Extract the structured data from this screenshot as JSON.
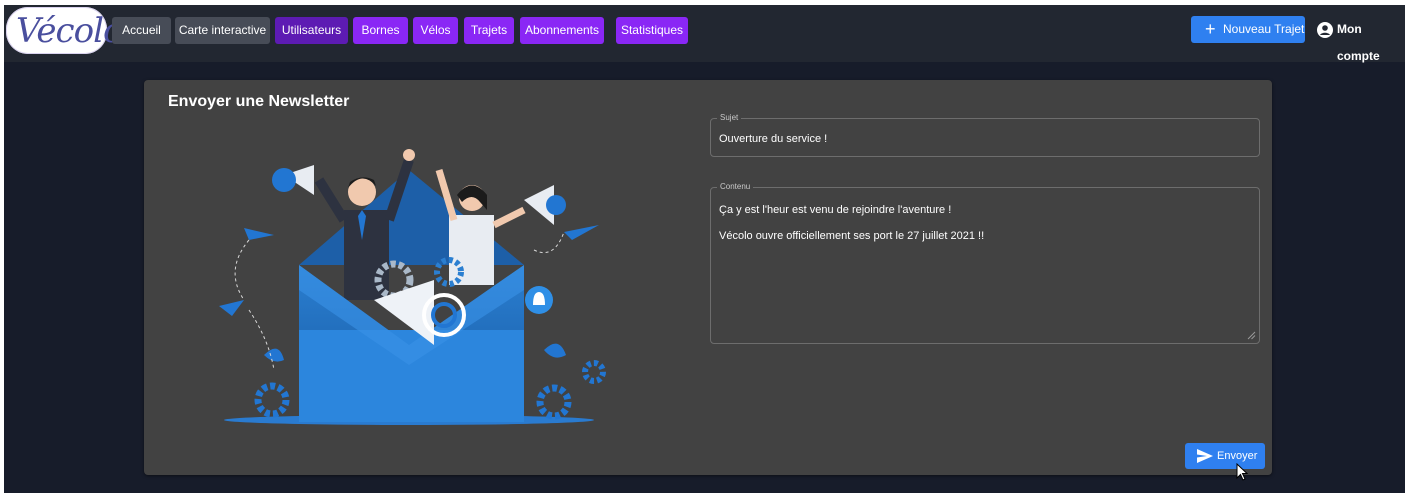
{
  "logo": {
    "text": "Vécolo"
  },
  "nav": {
    "accueil": "Accueil",
    "carte": "Carte interactive",
    "utilisateurs": "Utilisateurs",
    "bornes": "Bornes",
    "velos": "Vélos",
    "trajets": "Trajets",
    "abonnements": "Abonnements",
    "statistiques": "Statistiques"
  },
  "header_actions": {
    "new_trip": "Nouveau Trajet",
    "account": "Mon compte"
  },
  "newsletter": {
    "title": "Envoyer une Newsletter",
    "subject_label": "Sujet",
    "subject_value": "Ouverture du service !",
    "content_label": "Contenu",
    "content_line1": "Ça y est l'heur est venu de rejoindre l'aventure !",
    "content_line2": "Vécolo ouvre officiellement ses port le 27 juillet 2021 !!",
    "send": "Envoyer"
  },
  "colors": {
    "accent_purple": "#8a27f5",
    "active_purple": "#5d1bb3",
    "primary_blue": "#2f80f0",
    "card_bg": "#424242"
  }
}
